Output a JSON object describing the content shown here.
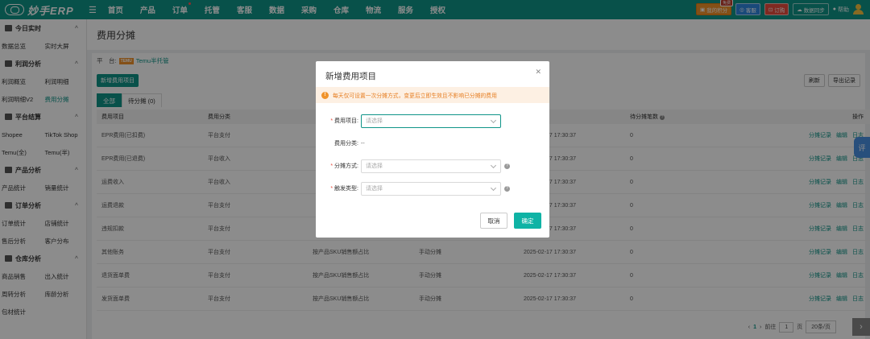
{
  "topbar": {
    "logo": "妙手ERP",
    "nav": [
      {
        "label": "首页",
        "dot": false
      },
      {
        "label": "产品",
        "dot": false
      },
      {
        "label": "订单",
        "dot": true
      },
      {
        "label": "托管",
        "dot": false
      },
      {
        "label": "客服",
        "dot": false
      },
      {
        "label": "数据",
        "dot": false
      },
      {
        "label": "采购",
        "dot": false
      },
      {
        "label": "仓库",
        "dot": false
      },
      {
        "label": "物流",
        "dot": false
      },
      {
        "label": "服务",
        "dot": false
      },
      {
        "label": "授权",
        "dot": false
      }
    ],
    "my_points": "我的积分",
    "my_points_badge": "免费",
    "service": "客服",
    "subscribe": "订购",
    "data_sync": "数据同步",
    "help": "帮助"
  },
  "sidebar": {
    "groups": [
      {
        "title": "今日实时",
        "rows": [
          [
            "数据总览",
            "实时大屏"
          ]
        ]
      },
      {
        "title": "利润分析",
        "rows": [
          [
            "利润概览",
            "利润明细"
          ],
          [
            "利润明细V2",
            "费用分摊"
          ]
        ]
      },
      {
        "title": "平台结算",
        "rows": [
          [
            "Shopee",
            "TikTok Shop"
          ],
          [
            "Temu(全)",
            "Temu(半)"
          ]
        ]
      },
      {
        "title": "产品分析",
        "rows": [
          [
            "产品统计",
            "销量统计"
          ]
        ]
      },
      {
        "title": "订单分析",
        "rows": [
          [
            "订单统计",
            "店铺统计"
          ],
          [
            "售后分析",
            "客户分布"
          ]
        ]
      },
      {
        "title": "仓库分析",
        "rows": [
          [
            "商品销售",
            "出入统计"
          ],
          [
            "周转分析",
            "库龄分析"
          ],
          [
            "包材统计",
            ""
          ]
        ]
      }
    ],
    "active": "费用分摊"
  },
  "page": {
    "title": "费用分摊",
    "platform_label": "平　台:",
    "platform_logo": "TEMU",
    "platform_name": "Temu半托管",
    "add_button": "新增费用项目",
    "refresh": "刷新",
    "export": "导出记录",
    "tabs": [
      "全部",
      "待分摊 (0)"
    ]
  },
  "table": {
    "headers": [
      "费用项目",
      "费用分类",
      "",
      "",
      "",
      "待分摊笔数",
      "操作"
    ],
    "rows": [
      [
        "EPR费用(已扣费)",
        "平台支付",
        "",
        "",
        "2025-02-17 17:30:37",
        "0"
      ],
      [
        "EPR费用(已退费)",
        "平台收入",
        "",
        "",
        "2025-02-17 17:30:37",
        "0"
      ],
      [
        "运费收入",
        "平台收入",
        "",
        "",
        "2025-02-17 17:30:37",
        "0"
      ],
      [
        "运费退款",
        "平台支付",
        "",
        "",
        "2025-02-17 17:30:37",
        "0"
      ],
      [
        "违规扣款",
        "平台支付",
        "",
        "",
        "2025-02-17 17:30:37",
        "0"
      ],
      [
        "其他账务",
        "平台支付",
        "按产品SKU销售额占比",
        "手动分摊",
        "2025-02-17 17:30:37",
        "0"
      ],
      [
        "退货面单费",
        "平台支付",
        "按产品SKU销售额占比",
        "手动分摊",
        "2025-02-17 17:30:37",
        "0"
      ],
      [
        "发货面单费",
        "平台支付",
        "按产品SKU销售额占比",
        "手动分摊",
        "2025-02-17 17:30:37",
        "0"
      ]
    ],
    "ops": [
      "分摊记录",
      "编辑",
      "日志"
    ]
  },
  "pager": {
    "current": "1",
    "goto_label": "前往",
    "goto_value": "1",
    "page_unit": "页",
    "page_size": "20条/页"
  },
  "side_float": "评",
  "dialog": {
    "title": "新增费用项目",
    "warning": "每天仅可设置一次分摊方式，变更后立即生效且不影响已分摊的费用",
    "item_label": "费用项目:",
    "item_placeholder": "请选择",
    "category_label": "费用分类:",
    "category_value": "--",
    "method_label": "分摊方式:",
    "method_placeholder": "请选择",
    "trigger_label": "触发类型:",
    "trigger_placeholder": "请选择",
    "cancel": "取消",
    "confirm": "确定"
  }
}
